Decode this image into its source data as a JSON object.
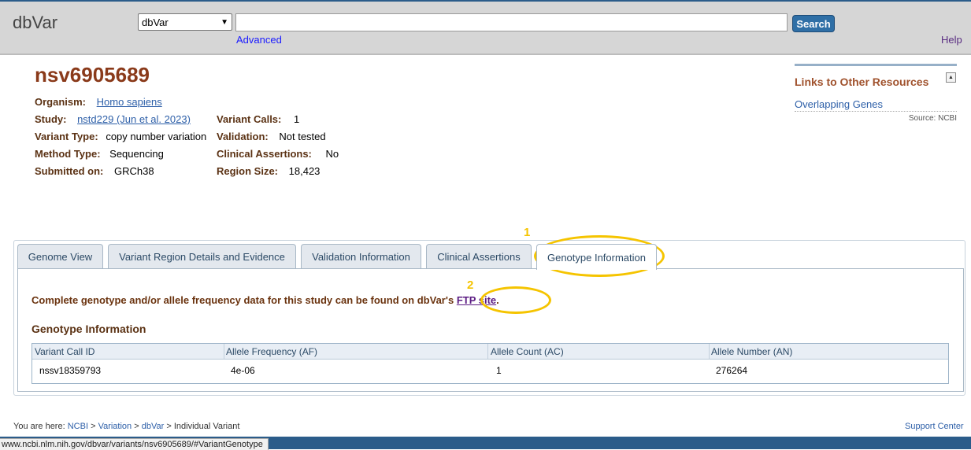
{
  "header": {
    "logo": "dbVar",
    "db_select": "dbVar",
    "search_value": "",
    "search_button": "Search",
    "advanced": "Advanced",
    "help": "Help"
  },
  "variant": {
    "title": "nsv6905689",
    "fields": {
      "organism_label": "Organism:",
      "organism_value": "Homo sapiens",
      "study_label": "Study:",
      "study_value": "nstd229 (Jun et al. 2023)",
      "variant_type_label": "Variant Type:",
      "variant_type_value": "copy number variation",
      "method_type_label": "Method Type:",
      "method_type_value": "Sequencing",
      "submitted_label": "Submitted on:",
      "submitted_value": "GRCh38",
      "calls_label": "Variant Calls:",
      "calls_value": "1",
      "validation_label": "Validation:",
      "validation_value": "Not tested",
      "clinical_label": "Clinical Assertions:",
      "clinical_value": "No",
      "region_label": "Region Size:",
      "region_value": "18,423"
    }
  },
  "links_panel": {
    "title": "Links to Other Resources",
    "overlapping_genes": "Overlapping Genes",
    "source": "Source: NCBI"
  },
  "tabs": [
    {
      "label": "Genome View"
    },
    {
      "label": "Variant Region Details and Evidence"
    },
    {
      "label": "Validation Information"
    },
    {
      "label": "Clinical Assertions"
    },
    {
      "label": "Genotype Information"
    }
  ],
  "genotype": {
    "message_prefix": "Complete genotype and/or allele frequency data for this study can be found on dbVar's",
    "ftp_link": "FTP site",
    "message_suffix": ".",
    "section_title": "Genotype Information",
    "columns": [
      "Variant Call ID",
      "Allele Frequency (AF)",
      "Allele Count (AC)",
      "Allele Number (AN)"
    ],
    "rows": [
      [
        "nssv18359793",
        "4e-06",
        "1",
        "276264"
      ]
    ]
  },
  "annotations": {
    "num1": "1",
    "num2": "2",
    "color": "#f5c400"
  },
  "breadcrumb": {
    "prefix": "You are here:",
    "ncbi": "NCBI",
    "variation": "Variation",
    "dbvar": "dbVar",
    "current": "Individual Variant",
    "sep": ">"
  },
  "footer": {
    "support": "Support Center",
    "status_url": "www.ncbi.nlm.nih.gov/dbvar/variants/nsv6905689/#VariantGenotype"
  }
}
